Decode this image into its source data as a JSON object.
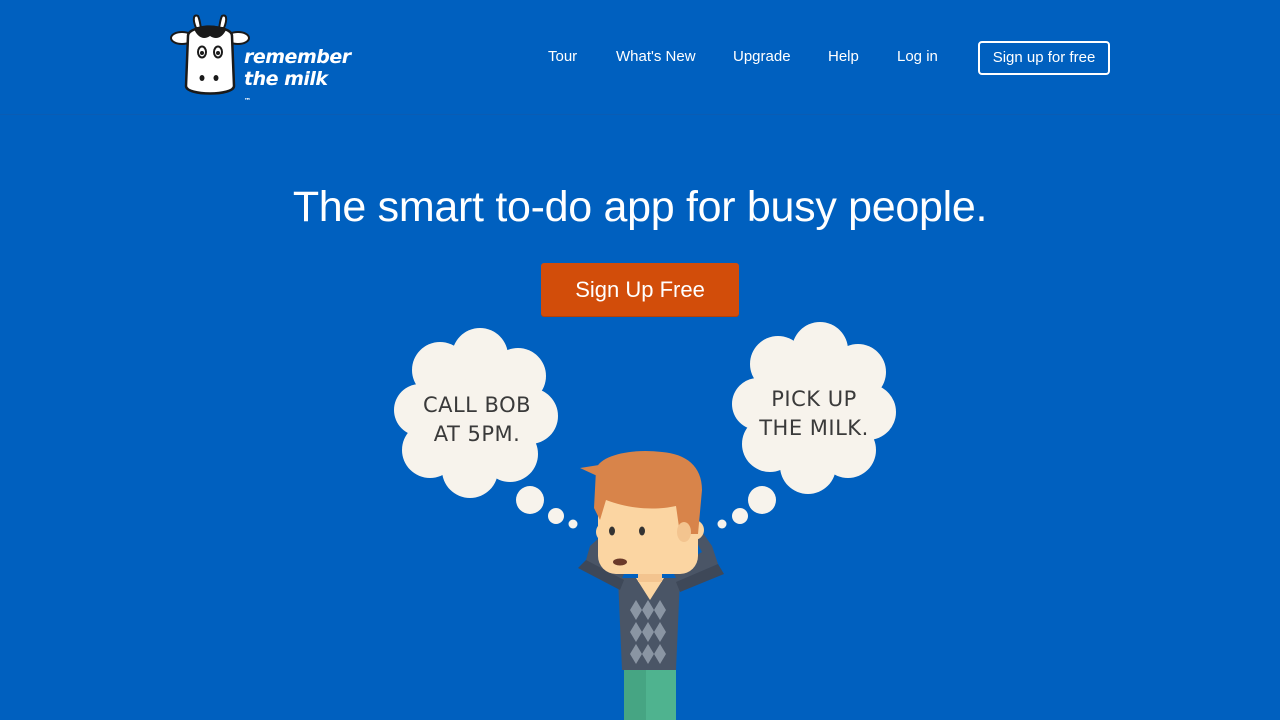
{
  "brand": {
    "name_line1": "remember",
    "name_line2": "the milk",
    "trademark": "™"
  },
  "nav": {
    "items": [
      {
        "label": "Tour"
      },
      {
        "label": "What's New"
      },
      {
        "label": "Upgrade"
      },
      {
        "label": "Help"
      },
      {
        "label": "Log in"
      }
    ],
    "signup_label": "Sign up for free"
  },
  "hero": {
    "headline": "The smart to-do app for busy people.",
    "cta_label": "Sign Up Free"
  },
  "illustration": {
    "bubble_left": {
      "line1": "CALL BOB",
      "line2": "AT 5PM."
    },
    "bubble_right": {
      "line1": "PICK UP",
      "line2": "THE MILK."
    }
  },
  "colors": {
    "background": "#0060bf",
    "cta": "#d24d0a",
    "bubble": "#f7f3ec",
    "hair": "#d8844a",
    "skin": "#fbd5a2",
    "sweater": "#4a5566",
    "pants": "#4fb38f"
  }
}
